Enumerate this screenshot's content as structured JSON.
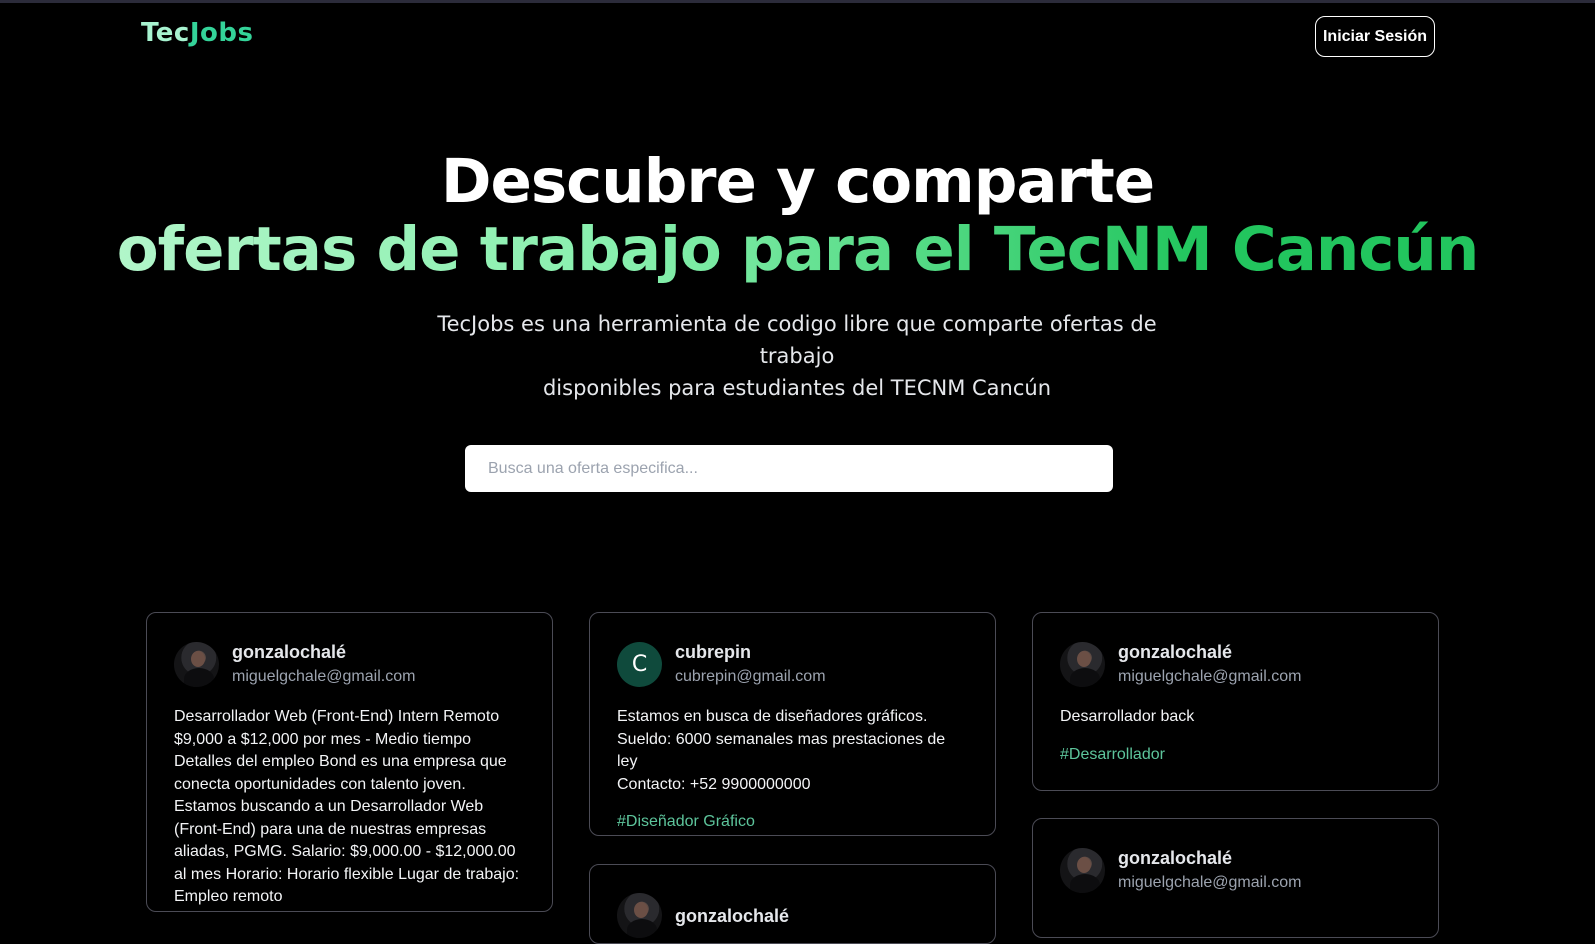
{
  "header": {
    "logo_part1": "Tec",
    "logo_part2": "Jobs",
    "login_label": "Iniciar Sesión"
  },
  "hero": {
    "title_line1": "Descubre y comparte",
    "title_line2": "ofertas de trabajo para el TecNM Cancún",
    "subtitle_line1": "TecJobs es una herramienta de codigo libre que comparte ofertas de trabajo",
    "subtitle_line2": "disponibles para estudiantes del TECNM Cancún"
  },
  "search": {
    "placeholder": "Busca una oferta especifica...",
    "value": ""
  },
  "posts": [
    {
      "user": "gonzalochalé",
      "email": "miguelgchale@gmail.com",
      "avatar": "photo",
      "text": "Desarrollador Web (Front-End) Intern Remoto $9,000 a $12,000 por mes - Medio tiempo Detalles del empleo Bond es una empresa que conecta oportunidades con talento joven. Estamos buscando a un Desarrollador Web (Front-End) para una de nuestras empresas aliadas, PGMG. Salario: $9,000.00 - $12,000.00 al mes Horario: Horario flexible Lugar de trabajo: Empleo remoto"
    },
    {
      "user": "cubrepin",
      "email": "cubrepin@gmail.com",
      "avatar": "letter",
      "avatar_letter": "C",
      "text_line1": "Estamos en busca de diseñadores gráficos.",
      "text_line2": "Sueldo: 6000 semanales mas prestaciones de ley",
      "text_line3": "Contacto: +52 9900000000",
      "tag": "#Diseñador Gráfico"
    },
    {
      "user": "gonzalochalé",
      "email": "miguelgchale@gmail.com",
      "avatar": "photo",
      "text": "Desarrollador back",
      "tag": "#Desarrollador"
    },
    {
      "user": "gonzalochalé",
      "email": "miguelgchale@gmail.com",
      "avatar": "photo"
    },
    {
      "user": "gonzalochalé",
      "avatar": "photo"
    }
  ],
  "colors": {
    "background": "#000000",
    "accent_green": "#22c55e",
    "accent_light_green": "#a7f3d0",
    "tag_green": "#6ee7b7",
    "avatar_teal": "#0f4a3c"
  }
}
